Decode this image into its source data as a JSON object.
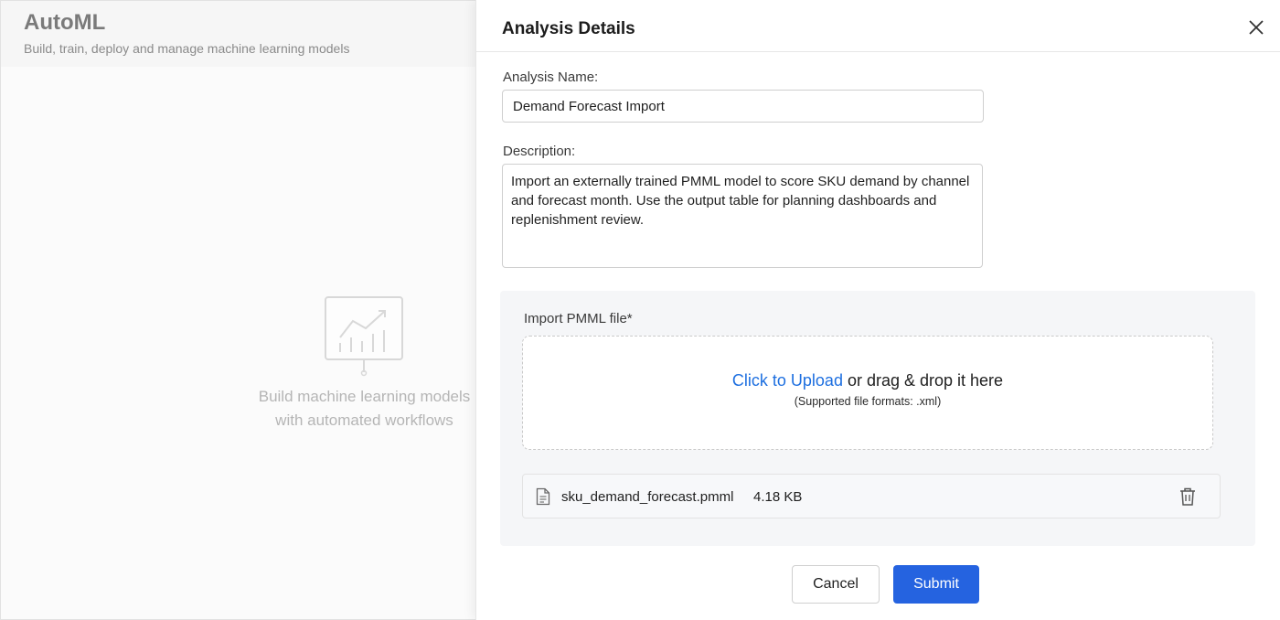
{
  "app": {
    "title": "AutoML",
    "subtitle": "Build, train, deploy and manage machine learning models",
    "empty_state": {
      "icon": "chart-presentation-icon",
      "line1": "Build machine learning models",
      "line2": "with automated workflows"
    }
  },
  "panel": {
    "title": "Analysis Details",
    "close_icon": "close-icon",
    "name_label": "Analysis Name:",
    "name_value": "Demand Forecast Import",
    "description_label": "Description:",
    "description_value": "Import an externally trained PMML model to score SKU demand by channel and forecast month. Use the output table for planning dashboards and replenishment review.",
    "import": {
      "label": "Import PMML file*",
      "link_text": "Click to Upload",
      "drop_text": " or drag & drop it here",
      "formats_text": "(Supported file formats: .xml)",
      "file": {
        "icon": "document-icon",
        "name": "sku_demand_forecast.pmml",
        "size": "4.18 KB",
        "delete_icon": "trash-icon"
      }
    },
    "cancel_label": "Cancel",
    "submit_label": "Submit"
  },
  "colors": {
    "accent": "#2563e0",
    "link": "#1d6fe0"
  }
}
